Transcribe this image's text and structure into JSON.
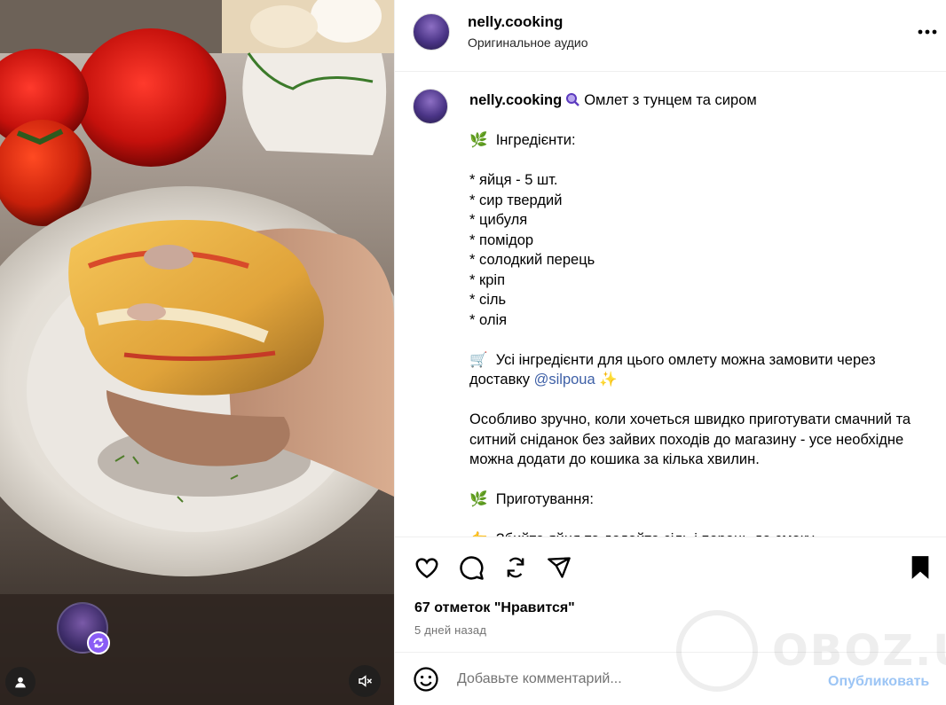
{
  "post": {
    "username": "nelly.cooking",
    "audio": "Оригинальное аудио",
    "more_label": "•••",
    "caption": {
      "username": "nelly.cooking",
      "title": "Омлет з тунцем та сиром",
      "body_1": "\n\n🌿  Інгредієнти:\n\n* яйця - 5 шт.\n* сир твердий\n* цибуля\n* помідор\n* солодкий перець\n* кріп\n* сіль\n* олія\n\n🛒  Усі інгредієнти для цього омлету можна замовити через доставку ",
      "mention": "@silpoua",
      "body_2": " ✨\n\nОсобливо зручно, коли хочеться швидко приготувати смачний та ситний сніданок без зайвих походів до магазину - усе необхідне можна додати до кошика за кілька хвилин.\n\n🌿  Приготування:\n\n👉  Збийте яйця та додайте сіль і перець до смаку."
    },
    "likes": "67 отметок \"Нравится\"",
    "time": "5 дней назад"
  },
  "comment": {
    "placeholder": "Добавьте комментарий...",
    "publish": "Опубликовать"
  },
  "watermark": {
    "text": "OBOZ.UA"
  },
  "colors": {
    "link": "#3d5fa6",
    "publish_disabled": "#9cc5f5",
    "accent_purple": "#8a5cf5"
  }
}
